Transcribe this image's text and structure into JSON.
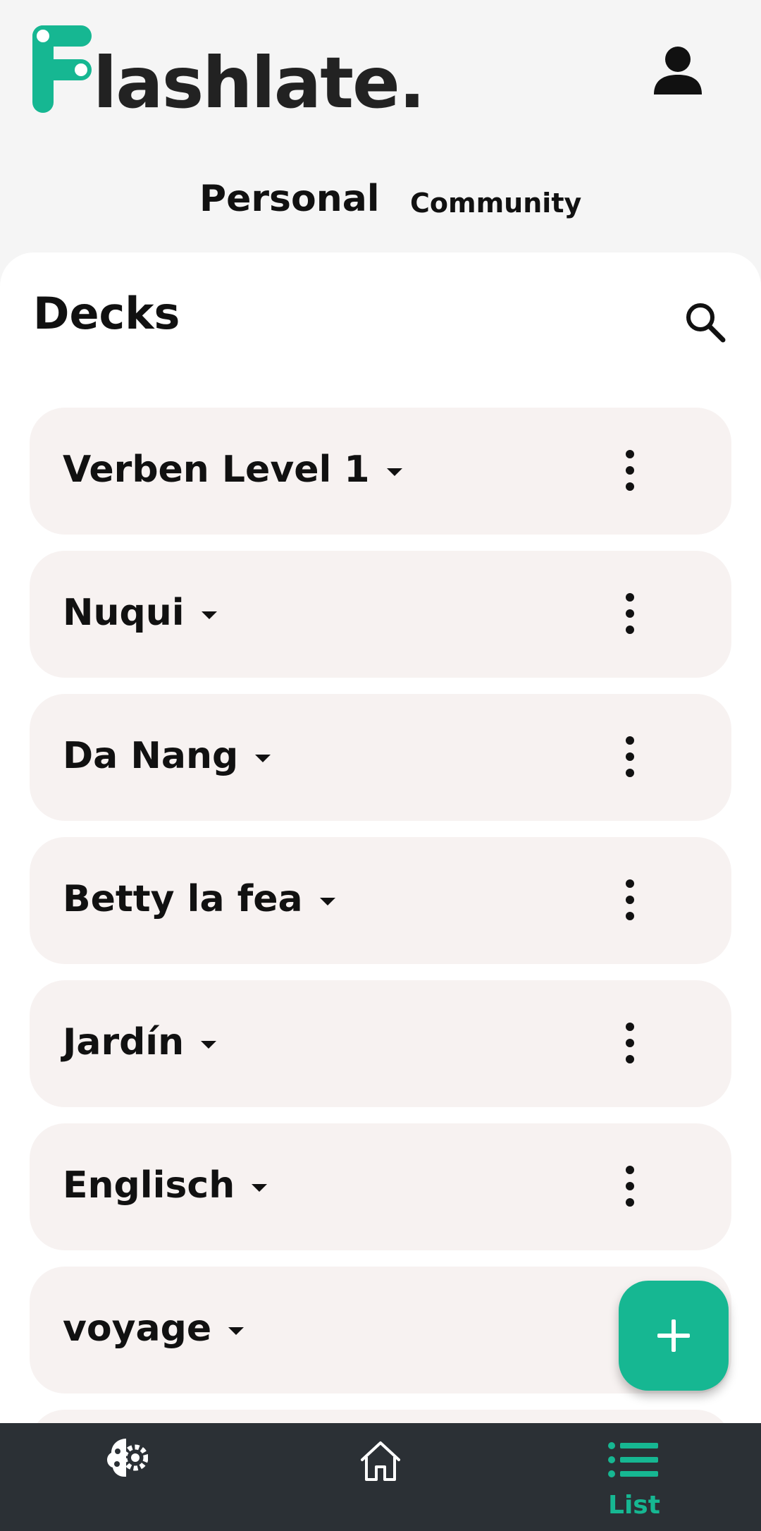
{
  "app": {
    "name": "lashlate.",
    "brand_color": "#16b792"
  },
  "header": {
    "profile_icon": "person-icon"
  },
  "tabs": [
    {
      "label": "Personal",
      "active": true
    },
    {
      "label": "Community",
      "active": false
    }
  ],
  "main": {
    "title": "Decks",
    "search_icon": "search-icon",
    "decks": [
      {
        "name": "Verben Level 1"
      },
      {
        "name": "Nuqui"
      },
      {
        "name": "Da Nang"
      },
      {
        "name": "Betty la fea"
      },
      {
        "name": "Jardín"
      },
      {
        "name": "Englisch"
      },
      {
        "name": "voyage"
      }
    ]
  },
  "fab": {
    "icon": "plus-icon"
  },
  "bottom_nav": {
    "items": [
      {
        "icon": "brain-gear-icon",
        "label": ""
      },
      {
        "icon": "home-icon",
        "label": ""
      },
      {
        "icon": "list-icon",
        "label": "List",
        "active": true
      }
    ]
  }
}
